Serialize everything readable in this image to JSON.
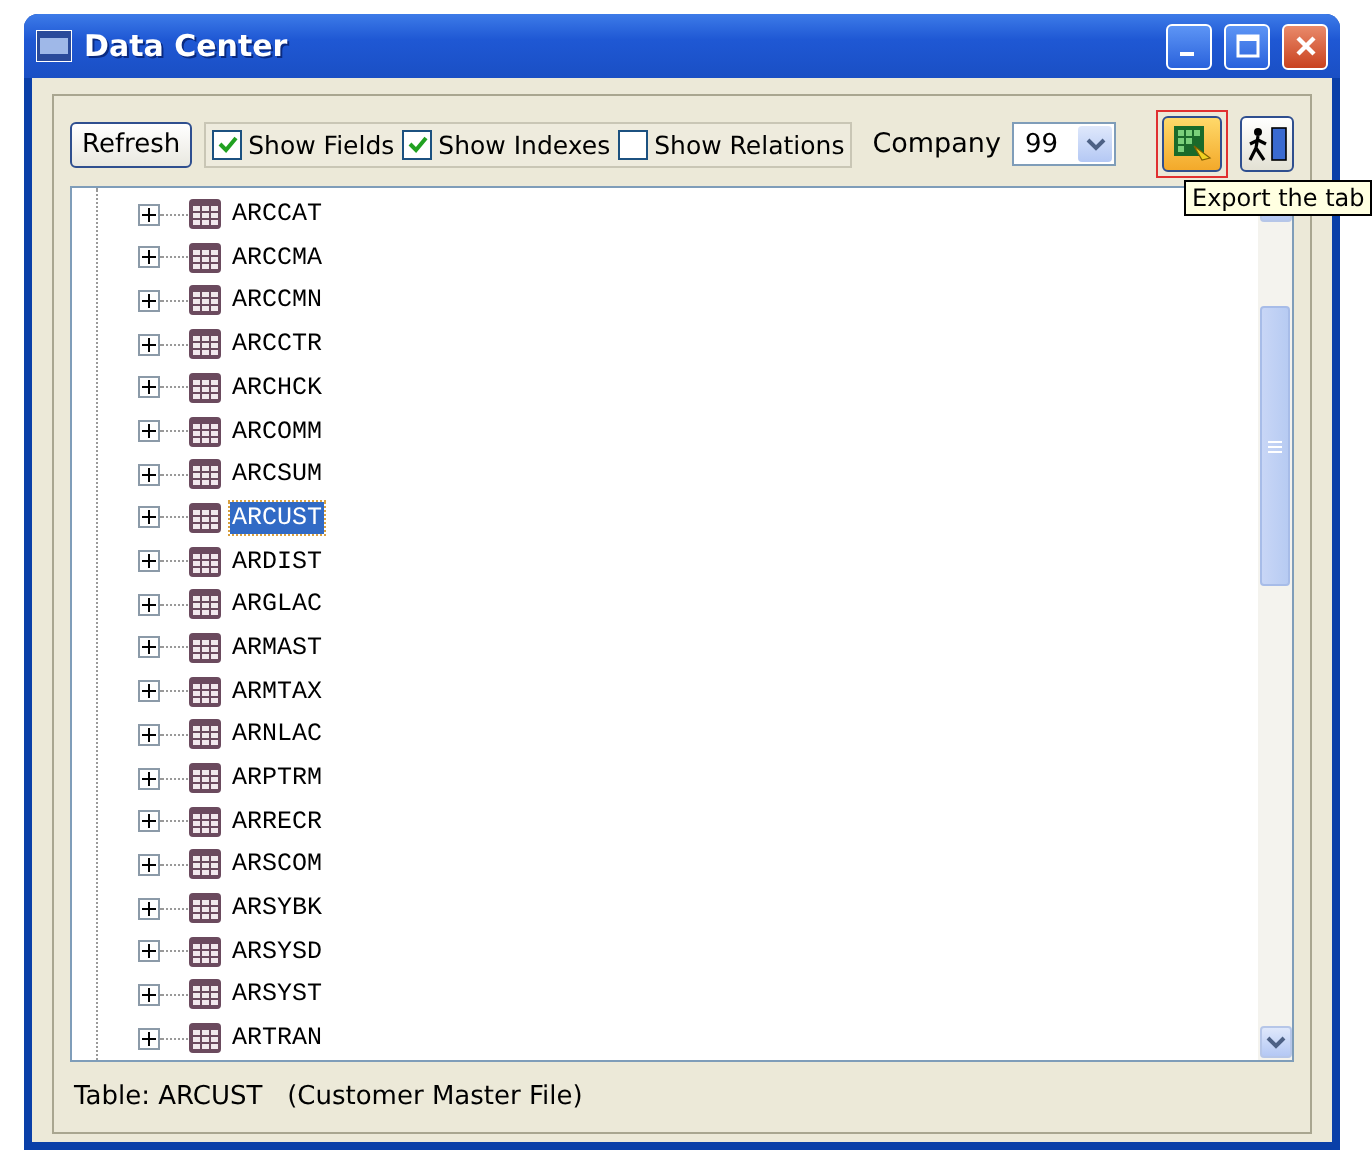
{
  "window": {
    "title": "Data Center"
  },
  "toolbar": {
    "refresh": "Refresh",
    "checkboxes": [
      {
        "label": "Show Fields",
        "checked": true
      },
      {
        "label": "Show Indexes",
        "checked": true
      },
      {
        "label": "Show Relations",
        "checked": false
      }
    ],
    "company_label": "Company",
    "company_value": "99",
    "export_button": {
      "highlighted": true,
      "tooltip": "Export the tab"
    }
  },
  "tree": {
    "items": [
      {
        "label": "ARCCAT",
        "selected": false
      },
      {
        "label": "ARCCMA",
        "selected": false
      },
      {
        "label": "ARCCMN",
        "selected": false
      },
      {
        "label": "ARCCTR",
        "selected": false
      },
      {
        "label": "ARCHCK",
        "selected": false
      },
      {
        "label": "ARCOMM",
        "selected": false
      },
      {
        "label": "ARCSUM",
        "selected": false
      },
      {
        "label": "ARCUST",
        "selected": true
      },
      {
        "label": "ARDIST",
        "selected": false
      },
      {
        "label": "ARGLAC",
        "selected": false
      },
      {
        "label": "ARMAST",
        "selected": false
      },
      {
        "label": "ARMTAX",
        "selected": false
      },
      {
        "label": "ARNLAC",
        "selected": false
      },
      {
        "label": "ARPTRM",
        "selected": false
      },
      {
        "label": "ARRECR",
        "selected": false
      },
      {
        "label": "ARSCOM",
        "selected": false
      },
      {
        "label": "ARSYBK",
        "selected": false
      },
      {
        "label": "ARSYSD",
        "selected": false
      },
      {
        "label": "ARSYST",
        "selected": false
      },
      {
        "label": "ARTRAN",
        "selected": false
      }
    ]
  },
  "status_bar": "Table: ARCUST   (Customer Master File)"
}
